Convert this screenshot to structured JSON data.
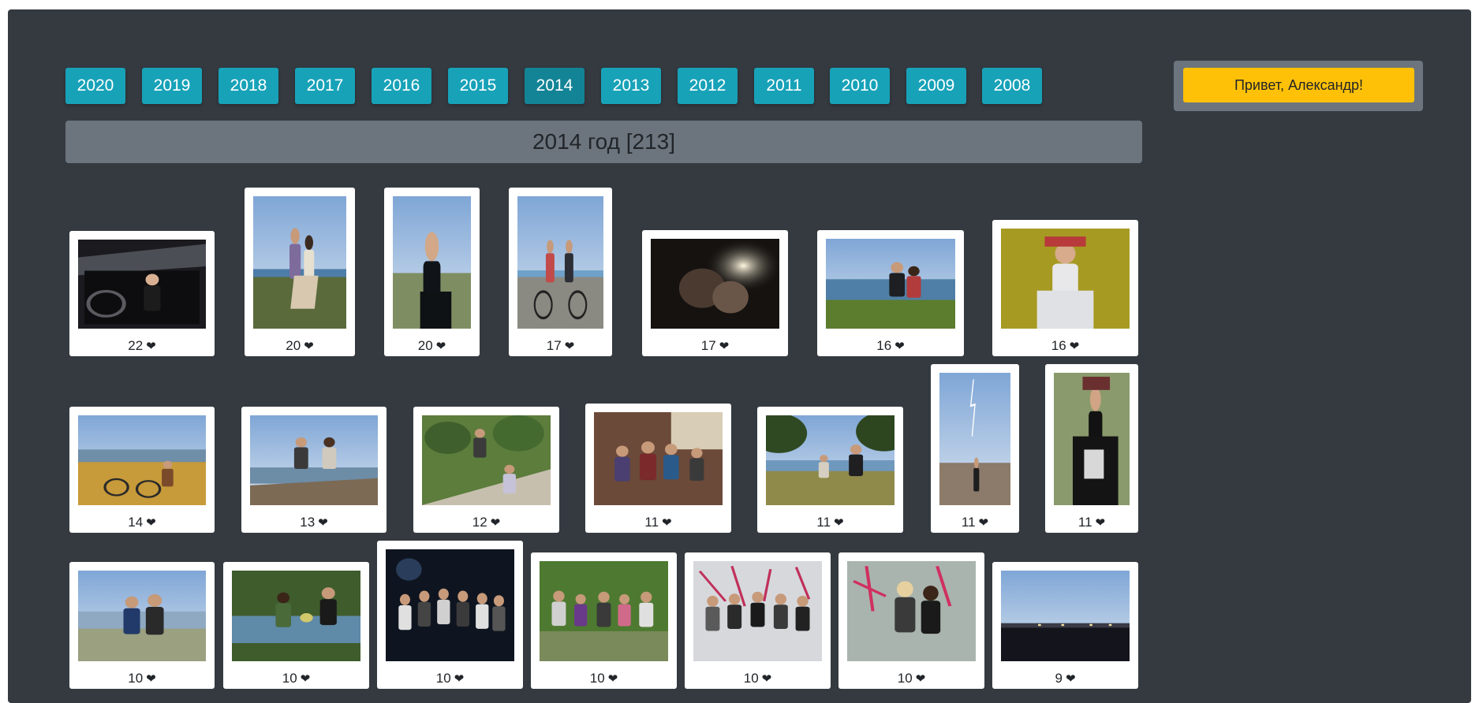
{
  "years": [
    "2020",
    "2019",
    "2018",
    "2017",
    "2016",
    "2015",
    "2014",
    "2013",
    "2012",
    "2011",
    "2010",
    "2009",
    "2008"
  ],
  "active_year": "2014",
  "header": {
    "title": "2014 год [213]"
  },
  "greeting": {
    "label": "Привет, Александр!"
  },
  "heart_glyph": "❤",
  "colors": {
    "background": "#343a40",
    "year_button": "#17a2b8",
    "year_button_active": "#138496",
    "header_bar": "#6c757d",
    "greeting_button": "#ffc107",
    "card": "#ffffff"
  },
  "photos": [
    {
      "likes": "22",
      "scene": "car"
    },
    {
      "likes": "20",
      "scene": "couple-dance"
    },
    {
      "likes": "20",
      "scene": "portrait-lake"
    },
    {
      "likes": "17",
      "scene": "couple-bike"
    },
    {
      "likes": "17",
      "scene": "dark-light"
    },
    {
      "likes": "16",
      "scene": "selfie-shore"
    },
    {
      "likes": "16",
      "scene": "yellow-wall"
    },
    {
      "likes": "14",
      "scene": "bike-grass"
    },
    {
      "likes": "13",
      "scene": "driftwood"
    },
    {
      "likes": "12",
      "scene": "slope"
    },
    {
      "likes": "11",
      "scene": "party"
    },
    {
      "likes": "11",
      "scene": "trees-shore"
    },
    {
      "likes": "11",
      "scene": "lightning"
    },
    {
      "likes": "11",
      "scene": "bald-cap"
    },
    {
      "likes": "10",
      "scene": "couple-winter"
    },
    {
      "likes": "10",
      "scene": "flowers"
    },
    {
      "likes": "10",
      "scene": "night-group"
    },
    {
      "likes": "10",
      "scene": "group-park"
    },
    {
      "likes": "10",
      "scene": "graffiti-group"
    },
    {
      "likes": "10",
      "scene": "graffiti-couple"
    },
    {
      "likes": "9",
      "scene": "night-city"
    }
  ]
}
